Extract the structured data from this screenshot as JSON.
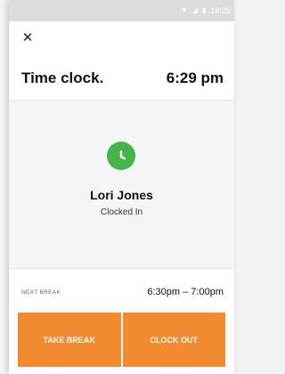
{
  "status_bar": {
    "icons": [
      "wifi-icon",
      "signal-icon",
      "battery-icon"
    ],
    "time": "16:29"
  },
  "header": {
    "close_icon": "close-icon",
    "title": "Time clock.",
    "current_time": "6:29 pm"
  },
  "user": {
    "avatar_icon": "clock-icon",
    "name": "Lori Jones",
    "status": "Clocked In"
  },
  "next_break": {
    "label": "NEXT BREAK",
    "range": "6:30pm – 7:00pm"
  },
  "actions": {
    "take_break": "TAKE BREAK",
    "clock_out": "CLOCK OUT"
  },
  "colors": {
    "accent": "#f28b30",
    "avatar": "#46b34b",
    "status_bar": "#dcdcdc"
  }
}
